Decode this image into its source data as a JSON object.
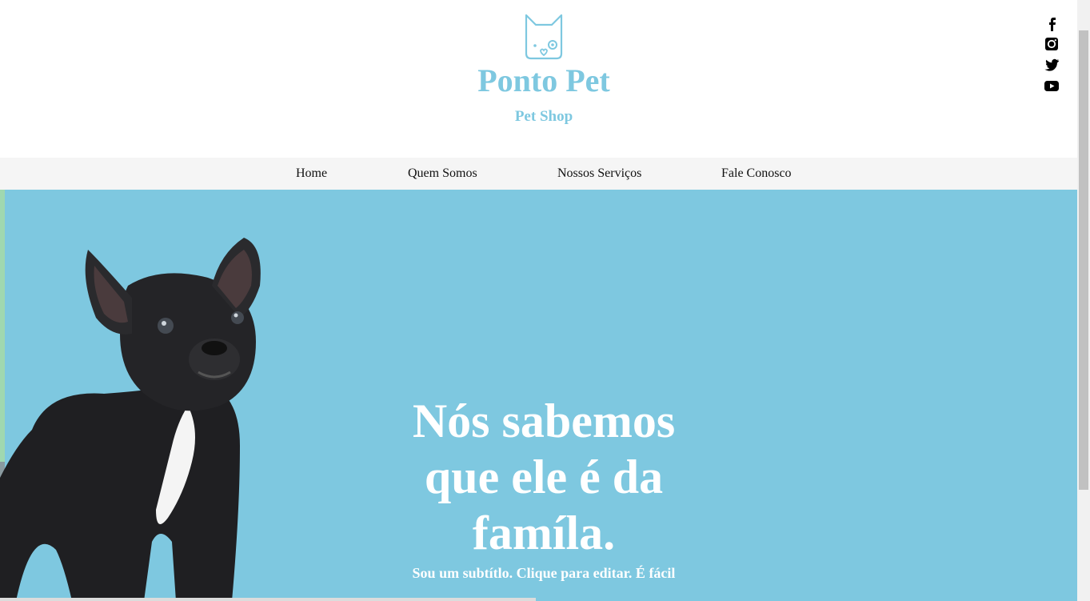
{
  "header": {
    "logo_icon": "dog-face-icon",
    "brand_name": "Ponto Pet",
    "brand_sub": "Pet Shop",
    "brand_color": "#7ec8e0"
  },
  "social": [
    "facebook-icon",
    "instagram-icon",
    "twitter-icon",
    "youtube-icon"
  ],
  "nav": {
    "items": [
      {
        "label": "Home"
      },
      {
        "label": "Quem Somos"
      },
      {
        "label": "Nossos Serviços"
      },
      {
        "label": "Fale Conosco"
      }
    ]
  },
  "hero": {
    "title_line1": "Nós sabemos",
    "title_line2": "que ele é da",
    "title_line3": "famíla.",
    "subtitle": "Sou um subtítlo. Clique para editar. É fácil",
    "background_color": "#7ec8e0",
    "image": "french-bulldog-photo"
  }
}
